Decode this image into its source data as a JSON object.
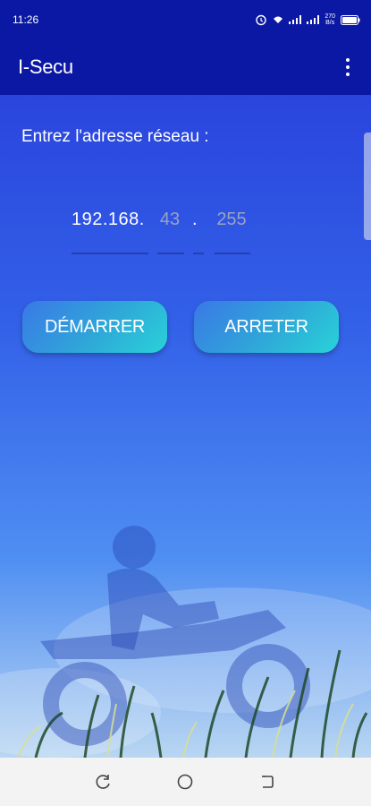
{
  "status_bar": {
    "time": "11:26",
    "net_speed_top": "270",
    "net_speed_bottom": "B/s",
    "icons": [
      "alarm-icon",
      "wifi-icon",
      "signal-icon",
      "signal-icon",
      "battery-icon"
    ]
  },
  "app_bar": {
    "title": "I-Secu",
    "menu_icon": "more-vert-icon"
  },
  "form": {
    "prompt": "Entrez l'adresse réseau :",
    "ip_prefix": "192.168.",
    "octet3_placeholder": "43",
    "separator": ".",
    "octet4_placeholder": "255"
  },
  "buttons": {
    "start_label": "DÉMARRER",
    "stop_label": "ARRETER"
  },
  "nav_bar": {
    "icons": [
      "recent-apps-icon",
      "home-icon",
      "back-icon"
    ]
  },
  "colors": {
    "app_bar": "#0b18a3",
    "button_gradient_start": "#3a78e6",
    "button_gradient_end": "#28d3d8"
  }
}
